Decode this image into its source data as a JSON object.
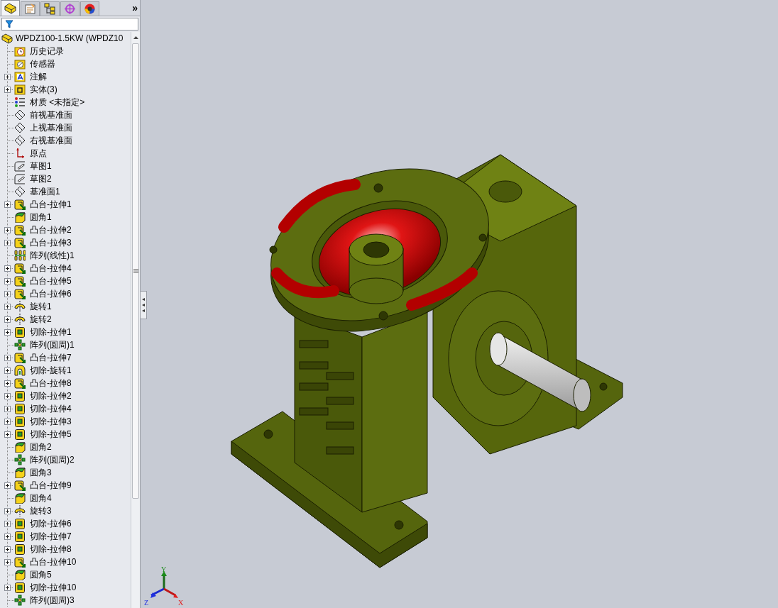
{
  "panel_tabs": [
    {
      "kind": "feature",
      "selected": true
    },
    {
      "kind": "property",
      "selected": false
    },
    {
      "kind": "config",
      "selected": false
    },
    {
      "kind": "dimxpert",
      "selected": false
    },
    {
      "kind": "display",
      "selected": false
    }
  ],
  "tabs_more": "»",
  "tree": {
    "root": "WPDZ100-1.5KW  (WPDZ10",
    "items": [
      {
        "label": "历史记录",
        "kind": "history",
        "collapsed": false
      },
      {
        "label": "传感器",
        "kind": "sensor",
        "collapsed": false
      },
      {
        "label": "注解",
        "kind": "annotation",
        "collapsed": true
      },
      {
        "label": "实体(3)",
        "kind": "solid",
        "collapsed": true
      },
      {
        "label": "材质 <未指定>",
        "kind": "material",
        "collapsed": false
      },
      {
        "label": "前视基准面",
        "kind": "plane",
        "collapsed": false
      },
      {
        "label": "上视基准面",
        "kind": "plane",
        "collapsed": false
      },
      {
        "label": "右视基准面",
        "kind": "plane",
        "collapsed": false
      },
      {
        "label": "原点",
        "kind": "origin",
        "collapsed": false
      },
      {
        "label": "草图1",
        "kind": "sketch",
        "collapsed": false
      },
      {
        "label": "草图2",
        "kind": "sketch",
        "collapsed": false
      },
      {
        "label": "基准面1",
        "kind": "plane",
        "collapsed": false
      },
      {
        "label": "凸台-拉伸1",
        "kind": "boss",
        "collapsed": true
      },
      {
        "label": "圆角1",
        "kind": "fillet",
        "collapsed": false
      },
      {
        "label": "凸台-拉伸2",
        "kind": "boss",
        "collapsed": true
      },
      {
        "label": "凸台-拉伸3",
        "kind": "boss",
        "collapsed": true
      },
      {
        "label": "阵列(线性)1",
        "kind": "linear_pattern",
        "collapsed": false
      },
      {
        "label": "凸台-拉伸4",
        "kind": "boss",
        "collapsed": true
      },
      {
        "label": "凸台-拉伸5",
        "kind": "boss",
        "collapsed": true
      },
      {
        "label": "凸台-拉伸6",
        "kind": "boss",
        "collapsed": true
      },
      {
        "label": "旋转1",
        "kind": "revolve",
        "collapsed": true
      },
      {
        "label": "旋转2",
        "kind": "revolve",
        "collapsed": true
      },
      {
        "label": "切除-拉伸1",
        "kind": "cut",
        "collapsed": true
      },
      {
        "label": "阵列(圆周)1",
        "kind": "circular_pattern",
        "collapsed": false
      },
      {
        "label": "凸台-拉伸7",
        "kind": "boss",
        "collapsed": true
      },
      {
        "label": "切除-旋转1",
        "kind": "cut_revolve",
        "collapsed": true
      },
      {
        "label": "凸台-拉伸8",
        "kind": "boss",
        "collapsed": true
      },
      {
        "label": "切除-拉伸2",
        "kind": "cut",
        "collapsed": true
      },
      {
        "label": "切除-拉伸4",
        "kind": "cut",
        "collapsed": true
      },
      {
        "label": "切除-拉伸3",
        "kind": "cut",
        "collapsed": true
      },
      {
        "label": "切除-拉伸5",
        "kind": "cut",
        "collapsed": true
      },
      {
        "label": "圆角2",
        "kind": "fillet",
        "collapsed": false
      },
      {
        "label": "阵列(圆周)2",
        "kind": "circular_pattern",
        "collapsed": false
      },
      {
        "label": "圆角3",
        "kind": "fillet",
        "collapsed": false
      },
      {
        "label": "凸台-拉伸9",
        "kind": "boss",
        "collapsed": true
      },
      {
        "label": "圆角4",
        "kind": "fillet",
        "collapsed": false
      },
      {
        "label": "旋转3",
        "kind": "revolve",
        "collapsed": true
      },
      {
        "label": "切除-拉伸6",
        "kind": "cut",
        "collapsed": true
      },
      {
        "label": "切除-拉伸7",
        "kind": "cut",
        "collapsed": true
      },
      {
        "label": "切除-拉伸8",
        "kind": "cut",
        "collapsed": true
      },
      {
        "label": "凸台-拉伸10",
        "kind": "boss",
        "collapsed": true
      },
      {
        "label": "圆角5",
        "kind": "fillet",
        "collapsed": false
      },
      {
        "label": "切除-拉伸10",
        "kind": "cut",
        "collapsed": true
      },
      {
        "label": "阵列(圆周)3",
        "kind": "circular_pattern",
        "collapsed": false
      }
    ]
  },
  "triad": {
    "x": "X",
    "y": "Y",
    "z": "Z"
  }
}
